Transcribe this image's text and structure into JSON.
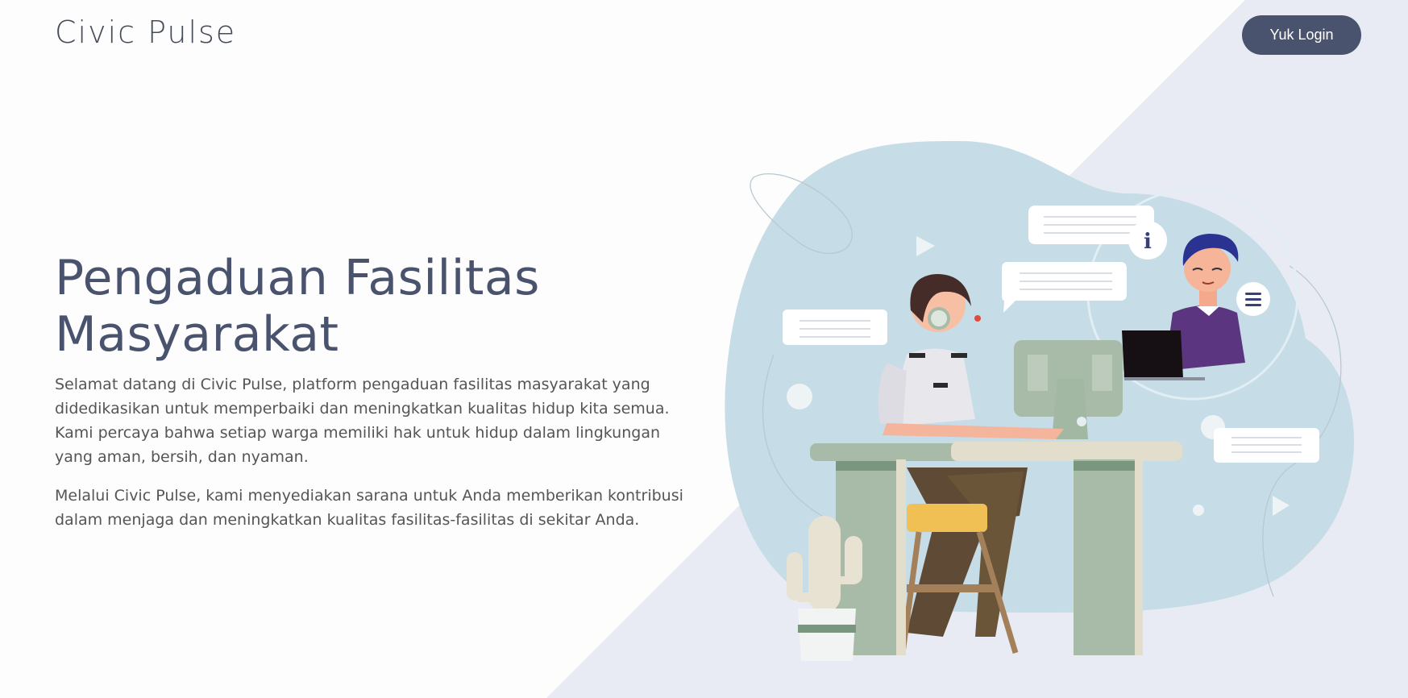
{
  "header": {
    "brand": "Civic Pulse",
    "login_label": "Yuk Login"
  },
  "hero": {
    "title_line1": "Pengaduan Fasilitas",
    "title_line2": "Masyarakat",
    "paragraph1": "Selamat datang di Civic Pulse, platform pengaduan fasilitas masyarakat yang didedikasikan untuk memperbaiki dan meningkatkan kualitas hidup kita semua. Kami percaya bahwa setiap warga memiliki hak untuk hidup dalam lingkungan yang aman, bersih, dan nyaman.",
    "paragraph2": "Melalui Civic Pulse, kami menyediakan sarana untuk Anda memberikan kontribusi dalam menjaga dan meningkatkan kualitas fasilitas-fasilitas di sekitar Anda."
  },
  "illustration": {
    "info_glyph": "i"
  },
  "colors": {
    "brand_dark": "#4a536e",
    "bg_diagonal": "#e8ebf4",
    "blob": "#c6dce6",
    "desk": "#a3b8a3"
  }
}
